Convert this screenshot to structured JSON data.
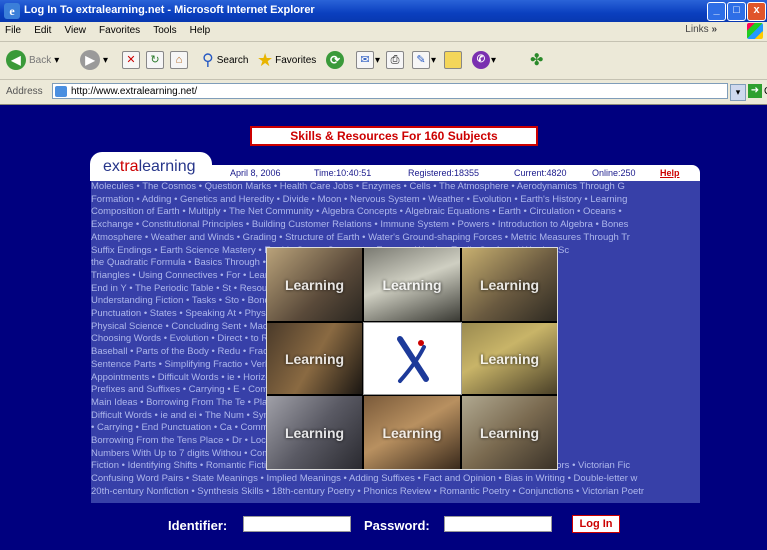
{
  "window": {
    "title": "Log In To extralearning.net - Microsoft Internet Explorer",
    "ie_icon_glyph": "e",
    "minimize": "_",
    "maximize": "□",
    "close": "x"
  },
  "menu": {
    "items": [
      "File",
      "Edit",
      "View",
      "Favorites",
      "Tools",
      "Help"
    ],
    "links_label": "Links",
    "links_chevron": "»"
  },
  "toolbar": {
    "back": "Back",
    "search": "Search",
    "favorites": "Favorites"
  },
  "address": {
    "label": "Address",
    "url": "http://www.extralearning.net/",
    "go": "Go"
  },
  "page": {
    "banner": "Skills & Resources For 160 Subjects",
    "logo_ex": "ex",
    "logo_tra": "tra",
    "logo_learning": "learning",
    "info": {
      "date": "April 8, 2006",
      "time": "Time:10:40:51",
      "registered": "Registered:18355",
      "current": "Current:4820",
      "online": "Online:250",
      "help": "Help"
    },
    "subject_lines": [
      "Molecules • The Cosmos • Question Marks • Health Care Jobs • Enzymes • Cells • The Atmosphere • Aerodynamics Through G",
      "Formation • Adding • Genetics and Heredity • Divide • Moon • Nervous System • Weather • Evolution • Earth's History • Learning",
      "Composition of Earth • Multiply • The Net Community • Algebra Concepts • Algebraic Equations • Earth • Circulation • Oceans •",
      "Exchange • Constitutional Principles • Building Customer Relations • Immune System • Powers • Introduction to Algebra • Bones",
      "Atmosphere • Weather and Winds • Grading • Structure of Earth • Water's Ground-shaping Forces • Metric Measures Through Tr",
      "Suffix Endings • Earth Science Mastery • Earth's Crust • Sentence • Energy • Words • Easily Confused Words • Sc",
      "the Quadratic Formula • Basics Through • Labels • Coping With Sadness •",
      "Triangles • Using Connectives • For • Learning • Perimeter • Learning V",
      "End in Y • The Periodic Table • St • Resources • GED Science Rea",
      "Understanding Fiction • Tasks • Sto • Bonding • Work Words • Spelli",
      "Punctuation • States • Speaking At • Physical Energy • Recognizing Illu",
      "Physical Science • Concluding Sent • Machines • Filing For Citizensh",
      "Choosing Words • Evolution • Direct • to Racing • Personal Letters •",
      "Baseball • Parts of the Body • Redu • Fractions • Possessives • Re",
      "Sentence Parts • Simplifying Fractio • Verbs • Fractions • Comparatives",
      "Appointments • Difficult Words • ie • Horizontal • Synonyms and",
      "Prefixes and Suffixes • Carrying • E • Commas, Semicolons and colons",
      "Main Ideas • Borrowing From The Te • Place • Locating Information •",
      "Difficult Words • ie and ei • The Num • Synonyms and Antonyms • The N",
      "• Carrying • End Punctuation • Ca • Commas and colons • Capitalization F",
      "Borrowing From the Tens Place • Dr • Locating Information • Borrowing F",
      "Numbers With Up to 7 digits Withou • Comparative Forms • Place Value",
      "Fiction • Identifying Shifts • Romantic Fiction • Analyzing Characters • Visual Words • Literary Devices • Metaphors • Victorian Fic",
      "Confusing Word Pairs • State Meanings • Implied Meanings • Adding Suffixes • Fact and Opinion • Bias in Writing • Double-letter w",
      "20th-century Nonfiction • Synthesis Skills • 18th-century Poetry • Phonics Review • Romantic Poetry • Conjunctions • Victorian Poetr"
    ],
    "photo_caption": "Learning",
    "form": {
      "identifier_label": "Identifier:",
      "password_label": "Password:",
      "identifier_value": "",
      "password_value": "",
      "login_label": "Log In"
    }
  }
}
